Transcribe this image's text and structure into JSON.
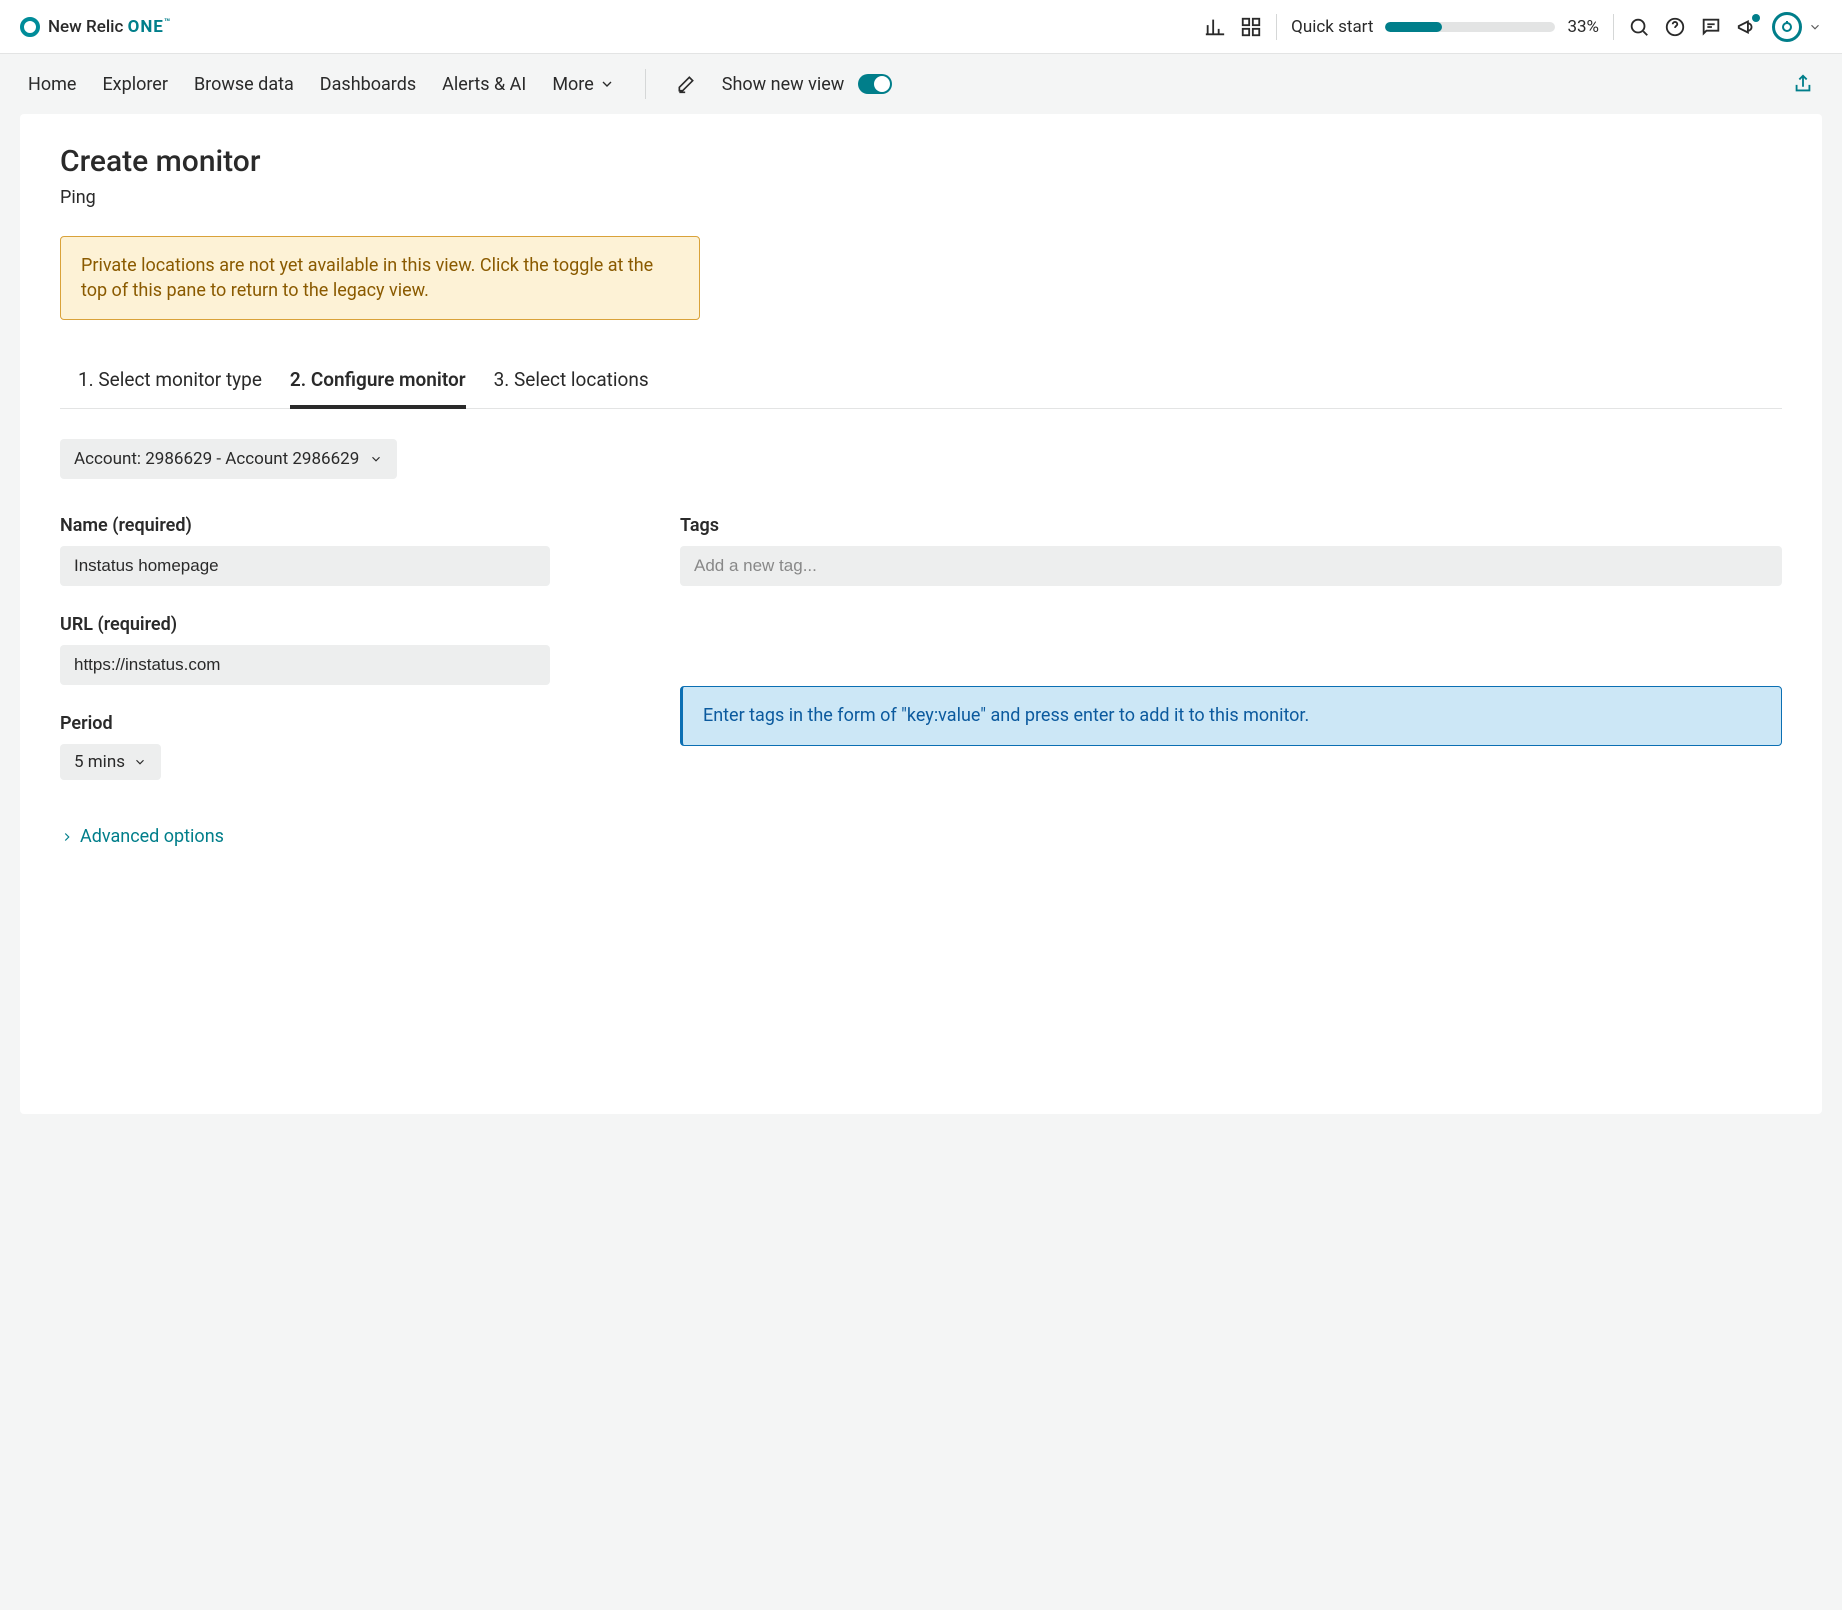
{
  "header": {
    "logo_text_1": "New Relic",
    "logo_text_2": "ONE",
    "logo_tm": "™",
    "quickstart_label": "Quick start",
    "quickstart_percent": "33%",
    "quickstart_fill_width": "33%"
  },
  "nav": {
    "items": [
      "Home",
      "Explorer",
      "Browse data",
      "Dashboards",
      "Alerts & AI"
    ],
    "more": "More",
    "show_new_view": "Show new view"
  },
  "page": {
    "title": "Create monitor",
    "subtitle": "Ping",
    "warning": "Private locations are not yet available in this view.  Click the toggle at the top of this pane to return to the legacy view."
  },
  "steps": [
    {
      "label": "1. Select monitor type",
      "active": false
    },
    {
      "label": "2. Configure monitor",
      "active": true
    },
    {
      "label": "3. Select locations",
      "active": false
    }
  ],
  "account_selector": "Account: 2986629 - Account 2986629",
  "form": {
    "name_label": "Name (required)",
    "name_value": "Instatus homepage",
    "url_label": "URL (required)",
    "url_value": "https://instatus.com",
    "period_label": "Period",
    "period_value": "5 mins",
    "tags_label": "Tags",
    "tags_placeholder": "Add a new tag...",
    "tags_info": "Enter tags in the form of \"key:value\" and press enter to add it to this monitor.",
    "advanced": "Advanced options"
  }
}
